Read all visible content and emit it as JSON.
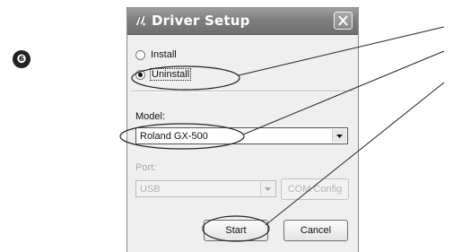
{
  "step_marker": "❻",
  "dialog": {
    "title": "Driver Setup",
    "close_icon": "close-icon",
    "install_label": "Install",
    "uninstall_label": "Uninstall",
    "selected_option": "Uninstall",
    "model_label": "Model:",
    "model_value": "Roland GX-500",
    "port_label": "Port:",
    "port_value": "USB",
    "com_config_label": "COM Config",
    "start_label": "Start",
    "cancel_label": "Cancel"
  }
}
